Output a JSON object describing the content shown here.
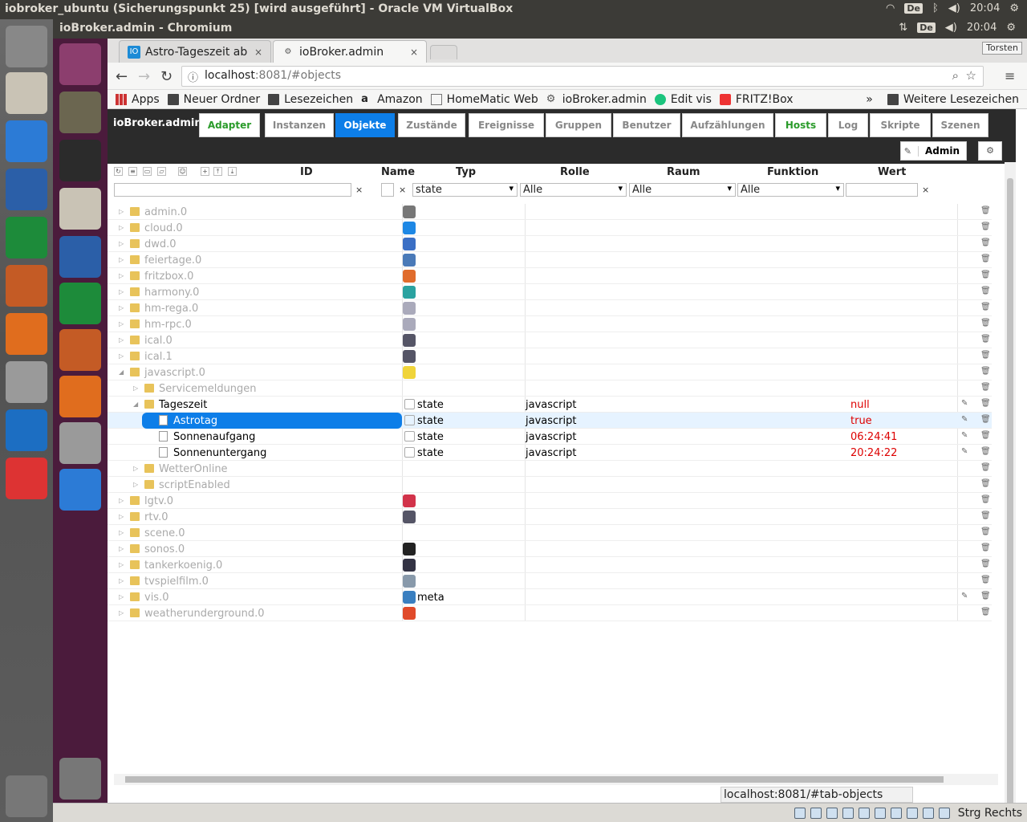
{
  "host": {
    "window_title": "iobroker_ubuntu (Sicherungspunkt 25) [wird ausgeführt] - Oracle VM VirtualBox",
    "keyboard": "De",
    "clock": "20:04",
    "host_key_label": "Strg Rechts"
  },
  "guest": {
    "window_title": "ioBroker.admin - Chromium",
    "keyboard": "De",
    "clock": "20:04",
    "user": "Torsten"
  },
  "browser": {
    "tabs": [
      {
        "label": "Astro-Tageszeit ab",
        "close": "×",
        "favicon": "IO"
      },
      {
        "label": "ioBroker.admin",
        "close": "×",
        "favicon": "⚙"
      }
    ],
    "address": {
      "host": "localhost",
      "rest": ":8081/#objects"
    },
    "bookmarks": [
      {
        "label": "Apps",
        "icon": "apps-grid-icon"
      },
      {
        "label": "Neuer Ordner",
        "icon": "folder-icon"
      },
      {
        "label": "Lesezeichen",
        "icon": "folder-icon"
      },
      {
        "label": "Amazon",
        "icon": "amazon-icon"
      },
      {
        "label": "HomeMatic Web",
        "icon": "page-icon"
      },
      {
        "label": "ioBroker.admin",
        "icon": "gear-icon"
      },
      {
        "label": "Edit vis",
        "icon": "vis-icon"
      },
      {
        "label": "FRITZ!Box",
        "icon": "fritzbox-icon"
      }
    ],
    "bookmarks_more": "»",
    "other_bookmarks": "Weitere Lesezeichen",
    "status_url": "localhost:8081/#tab-objects"
  },
  "app": {
    "brand": "ioBroker.admin",
    "tabs": [
      {
        "label": "Adapter",
        "style": "green"
      },
      {
        "label": "Instanzen",
        "style": "plain"
      },
      {
        "label": "Objekte",
        "style": "active"
      },
      {
        "label": "Zustände",
        "style": "plain"
      },
      {
        "label": "Ereignisse",
        "style": "plain"
      },
      {
        "label": "Gruppen",
        "style": "plain"
      },
      {
        "label": "Benutzer",
        "style": "plain"
      },
      {
        "label": "Aufzählungen",
        "style": "plain"
      },
      {
        "label": "Hosts",
        "style": "green"
      },
      {
        "label": "Log",
        "style": "plain"
      },
      {
        "label": "Skripte",
        "style": "plain"
      },
      {
        "label": "Szenen",
        "style": "plain"
      }
    ],
    "user": "Admin",
    "columns": {
      "id": "ID",
      "name": "Name",
      "type": "Typ",
      "role": "Rolle",
      "room": "Raum",
      "function": "Funktion",
      "value": "Wert"
    },
    "filters": {
      "id": "",
      "name": "",
      "type": "state",
      "role": "Alle",
      "room": "Alle",
      "function": "Alle",
      "value": "",
      "clear": "×"
    },
    "rows": [
      {
        "id": "admin.0",
        "level": 0,
        "kind": "folder",
        "dim": true,
        "expanded": false,
        "icon": "gear-icon",
        "icon_color": "#777",
        "name": "",
        "type": "",
        "role": "",
        "value": "",
        "edit": false
      },
      {
        "id": "cloud.0",
        "level": 0,
        "kind": "folder",
        "dim": true,
        "expanded": false,
        "icon": "cloud-icon",
        "icon_color": "#1e88e5",
        "name": "",
        "type": "",
        "role": "",
        "value": "",
        "edit": false
      },
      {
        "id": "dwd.0",
        "level": 0,
        "kind": "folder",
        "dim": true,
        "expanded": false,
        "icon": "weather-icon",
        "icon_color": "#3b6fc5",
        "name": "",
        "type": "",
        "role": "",
        "value": "",
        "edit": false
      },
      {
        "id": "feiertage.0",
        "level": 0,
        "kind": "folder",
        "dim": true,
        "expanded": false,
        "icon": "calendar-icon",
        "icon_color": "#4a7ab8",
        "name": "",
        "type": "",
        "role": "",
        "value": "",
        "edit": false
      },
      {
        "id": "fritzbox.0",
        "level": 0,
        "kind": "folder",
        "dim": true,
        "expanded": false,
        "icon": "phone-icon",
        "icon_color": "#e06c2c",
        "name": "",
        "type": "",
        "role": "",
        "value": "",
        "edit": false
      },
      {
        "id": "harmony.0",
        "level": 0,
        "kind": "folder",
        "dim": true,
        "expanded": false,
        "icon": "harmony-icon",
        "icon_color": "#2aa2a0",
        "name": "",
        "type": "",
        "role": "",
        "value": "",
        "edit": false
      },
      {
        "id": "hm-rega.0",
        "level": 0,
        "kind": "folder",
        "dim": true,
        "expanded": false,
        "icon": "page-icon",
        "icon_color": "#aab",
        "name": "",
        "type": "",
        "role": "",
        "value": "",
        "edit": false
      },
      {
        "id": "hm-rpc.0",
        "level": 0,
        "kind": "folder",
        "dim": true,
        "expanded": false,
        "icon": "page-icon",
        "icon_color": "#aab",
        "name": "",
        "type": "",
        "role": "",
        "value": "",
        "edit": false
      },
      {
        "id": "ical.0",
        "level": 0,
        "kind": "folder",
        "dim": true,
        "expanded": false,
        "icon": "calendar-icon",
        "icon_color": "#556",
        "name": "",
        "type": "",
        "role": "",
        "value": "",
        "edit": false
      },
      {
        "id": "ical.1",
        "level": 0,
        "kind": "folder",
        "dim": true,
        "expanded": false,
        "icon": "calendar-icon",
        "icon_color": "#556",
        "name": "",
        "type": "",
        "role": "",
        "value": "",
        "edit": false
      },
      {
        "id": "javascript.0",
        "level": 0,
        "kind": "folder",
        "dim": true,
        "expanded": true,
        "icon": "js-icon",
        "icon_color": "#f0d43a",
        "name": "",
        "type": "",
        "role": "",
        "value": "",
        "edit": false
      },
      {
        "id": "Servicemeldungen",
        "level": 1,
        "kind": "folder",
        "dim": true,
        "expanded": false,
        "icon": "",
        "icon_color": "",
        "name": "",
        "type": "",
        "role": "",
        "value": "",
        "edit": false
      },
      {
        "id": "Tageszeit",
        "level": 1,
        "kind": "folder",
        "dim": false,
        "expanded": true,
        "icon": "state-icon",
        "icon_color": "",
        "name": "",
        "type": "state",
        "role": "javascript",
        "value": "null",
        "edit": true
      },
      {
        "id": "Astrotag",
        "level": 2,
        "kind": "doc",
        "dim": false,
        "expanded": false,
        "selected": true,
        "icon": "state-icon",
        "icon_color": "",
        "name": "",
        "type": "state",
        "role": "javascript",
        "value": "true",
        "edit": true
      },
      {
        "id": "Sonnenaufgang",
        "level": 2,
        "kind": "doc",
        "dim": false,
        "expanded": false,
        "icon": "state-icon",
        "icon_color": "",
        "name": "",
        "type": "state",
        "role": "javascript",
        "value": "06:24:41",
        "edit": true
      },
      {
        "id": "Sonnenuntergang",
        "level": 2,
        "kind": "doc",
        "dim": false,
        "expanded": false,
        "icon": "state-icon",
        "icon_color": "",
        "name": "",
        "type": "state",
        "role": "javascript",
        "value": "20:24:22",
        "edit": true
      },
      {
        "id": "WetterOnline",
        "level": 1,
        "kind": "folder",
        "dim": true,
        "expanded": false,
        "icon": "",
        "icon_color": "",
        "name": "",
        "type": "",
        "role": "",
        "value": "",
        "edit": false
      },
      {
        "id": "scriptEnabled",
        "level": 1,
        "kind": "folder",
        "dim": true,
        "expanded": false,
        "icon": "",
        "icon_color": "",
        "name": "",
        "type": "",
        "role": "",
        "value": "",
        "edit": false
      },
      {
        "id": "lgtv.0",
        "level": 0,
        "kind": "folder",
        "dim": true,
        "expanded": false,
        "icon": "lgtv-icon",
        "icon_color": "#d2334a",
        "name": "",
        "type": "",
        "role": "",
        "value": "",
        "edit": false
      },
      {
        "id": "rtv.0",
        "level": 0,
        "kind": "folder",
        "dim": true,
        "expanded": false,
        "icon": "tv-guide-icon",
        "icon_color": "#556",
        "name": "",
        "type": "",
        "role": "",
        "value": "",
        "edit": false
      },
      {
        "id": "scene.0",
        "level": 0,
        "kind": "folder",
        "dim": true,
        "expanded": false,
        "icon": "",
        "icon_color": "",
        "name": "",
        "type": "",
        "role": "",
        "value": "",
        "edit": false
      },
      {
        "id": "sonos.0",
        "level": 0,
        "kind": "folder",
        "dim": true,
        "expanded": false,
        "icon": "sonos-icon",
        "icon_color": "#222",
        "name": "",
        "type": "",
        "role": "",
        "value": "",
        "edit": false
      },
      {
        "id": "tankerkoenig.0",
        "level": 0,
        "kind": "folder",
        "dim": true,
        "expanded": false,
        "icon": "fuel-icon",
        "icon_color": "#334",
        "name": "",
        "type": "",
        "role": "",
        "value": "",
        "edit": false
      },
      {
        "id": "tvspielfilm.0",
        "level": 0,
        "kind": "folder",
        "dim": true,
        "expanded": false,
        "icon": "tv-icon",
        "icon_color": "#89a",
        "name": "",
        "type": "",
        "role": "",
        "value": "",
        "edit": false
      },
      {
        "id": "vis.0",
        "level": 0,
        "kind": "folder",
        "dim": true,
        "expanded": false,
        "icon": "vis-icon",
        "icon_color": "#3a7fc0",
        "name": "meta",
        "type": "",
        "role": "",
        "value": "",
        "edit": true
      },
      {
        "id": "weatherunderground.0",
        "level": 0,
        "kind": "folder",
        "dim": true,
        "expanded": false,
        "icon": "wunderground-icon",
        "icon_color": "#e04a2a",
        "name": "",
        "type": "",
        "role": "",
        "value": "",
        "edit": false
      }
    ]
  },
  "colors": {
    "accent": "#0d7ee8",
    "green": "#2a9b2a",
    "value_red": "#d00000",
    "launcher": "#4b1b3c"
  }
}
